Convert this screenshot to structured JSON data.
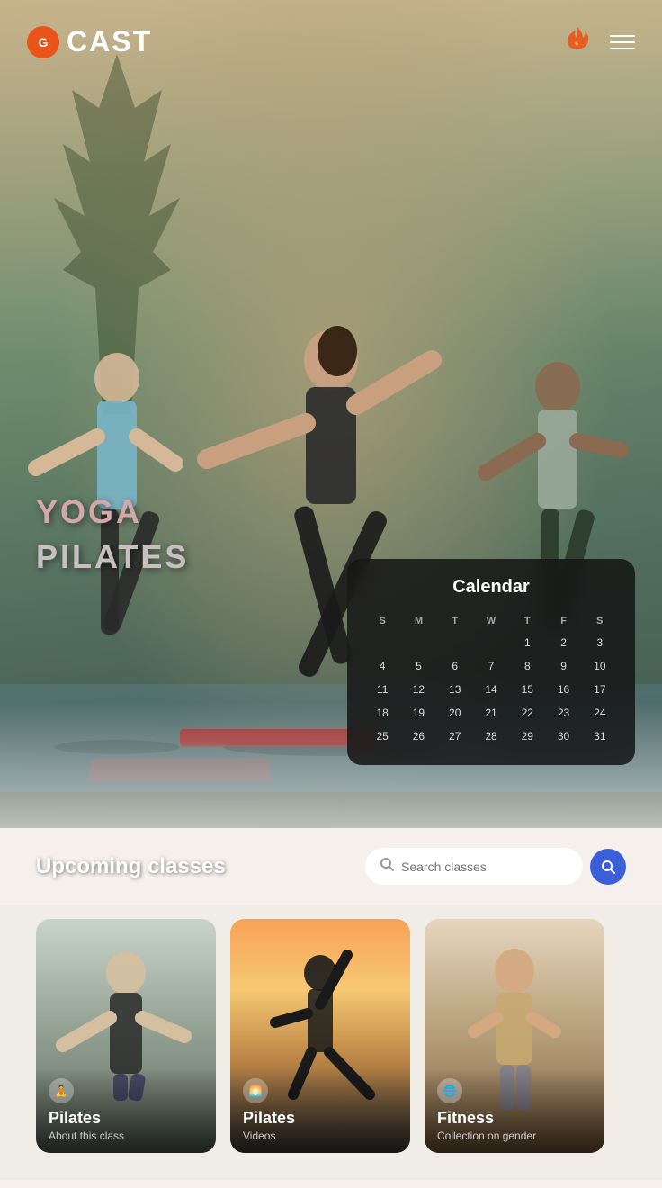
{
  "app": {
    "name": "CAST",
    "logo_symbol": "G"
  },
  "header": {
    "title": "CAST",
    "menu_label": "Menu"
  },
  "hero": {
    "tag1": "YOGA",
    "tag2": "PILATES"
  },
  "calendar": {
    "title": "Calendar",
    "days_header": [
      "S",
      "M",
      "T",
      "W",
      "T",
      "F",
      "S",
      "S"
    ],
    "week1": [
      "",
      "",
      "",
      "",
      "1",
      "2",
      "3",
      "4"
    ],
    "week2": [
      "5",
      "6",
      "7",
      "8",
      "9",
      "10",
      "11"
    ],
    "week3": [
      "12",
      "13",
      "14",
      "15",
      "16",
      "17",
      "18"
    ],
    "week4": [
      "19",
      "20",
      "21",
      "22",
      "23",
      "24",
      "25"
    ],
    "week5": [
      "26",
      "27",
      "28",
      "29",
      "30",
      "31",
      ""
    ]
  },
  "upcoming": {
    "label": "Upcoming classes",
    "search_placeholder": "Search classes"
  },
  "classes": [
    {
      "name": "Pilates",
      "description": "About this class",
      "icon": "🧘",
      "color_start": "#b8c8b8",
      "color_end": "#506050"
    },
    {
      "name": "Pilates",
      "description": "Videos",
      "icon": "🌅",
      "color_start": "#d4c890",
      "color_end": "#604830"
    },
    {
      "name": "Fitness",
      "description": "Collection on gender",
      "icon": "🌐",
      "color_start": "#d4c0b0",
      "color_end": "#805040"
    }
  ]
}
